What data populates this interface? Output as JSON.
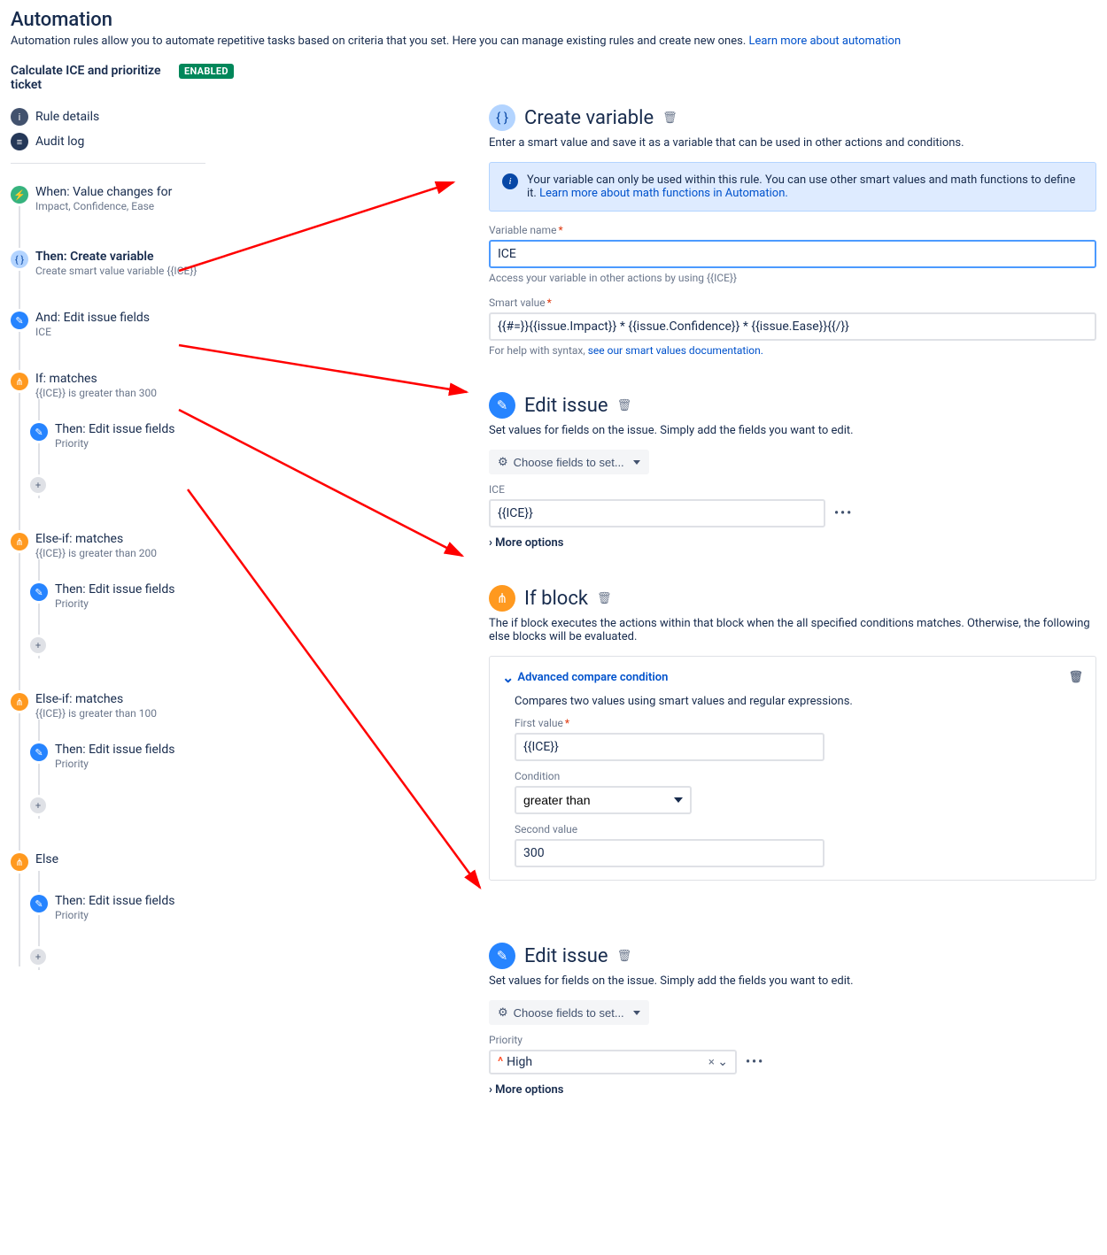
{
  "header": {
    "title": "Automation",
    "intro_text": "Automation rules allow you to automate repetitive tasks based on criteria that you set. Here you can manage existing rules and create new ones. ",
    "intro_link": "Learn more about automation"
  },
  "rule": {
    "name": "Calculate ICE and prioritize ticket",
    "status": "ENABLED"
  },
  "leftnav": {
    "details": "Rule details",
    "audit": "Audit log"
  },
  "tree": {
    "when": {
      "title": "When: Value changes for",
      "sub": "Impact, Confidence, Ease"
    },
    "then_create": {
      "title": "Then: Create variable",
      "sub": "Create smart value variable {{ICE}}"
    },
    "and_edit": {
      "title": "And: Edit issue fields",
      "sub": "ICE"
    },
    "if1": {
      "title": "If: matches",
      "sub": "{{ICE}} is greater than 300"
    },
    "if1_then": {
      "title": "Then: Edit issue fields",
      "sub": "Priority"
    },
    "elif2": {
      "title": "Else-if: matches",
      "sub": "{{ICE}} is greater than 200"
    },
    "elif2_then": {
      "title": "Then: Edit issue fields",
      "sub": "Priority"
    },
    "elif3": {
      "title": "Else-if: matches",
      "sub": "{{ICE}} is greater than 100"
    },
    "elif3_then": {
      "title": "Then: Edit issue fields",
      "sub": "Priority"
    },
    "else": {
      "title": "Else"
    },
    "else_then": {
      "title": "Then: Edit issue fields",
      "sub": "Priority"
    }
  },
  "panels": {
    "create_var": {
      "title": "Create variable",
      "desc": "Enter a smart value and save it as a variable that can be used in other actions and conditions.",
      "info_pre": "Your variable can only be used within this rule. You can use other smart values and math functions to define it. ",
      "info_link": "Learn more about math functions in Automation.",
      "var_label": "Variable name",
      "var_value": "ICE",
      "var_help": "Access your variable in other actions by using {{ICE}}",
      "sv_label": "Smart value",
      "sv_value": "{{#=}}{{issue.Impact}} * {{issue.Confidence}} * {{issue.Ease}}{{/}}",
      "sv_help_pre": "For help with syntax, ",
      "sv_help_link": "see our smart values documentation."
    },
    "edit1": {
      "title": "Edit issue",
      "desc": "Set values for fields on the issue. Simply add the fields you want to edit.",
      "choose": "Choose fields to set...",
      "field_label": "ICE",
      "field_value": "{{ICE}}",
      "more": "More options"
    },
    "ifblock": {
      "title": "If block",
      "desc": "The if block executes the actions within that block when the all specified conditions matches. Otherwise, the following else blocks will be evaluated.",
      "cond_title": "Advanced compare condition",
      "cond_desc": "Compares two values using smart values and regular expressions.",
      "first_label": "First value",
      "first_value": "{{ICE}}",
      "cond_label": "Condition",
      "cond_value": "greater than",
      "second_label": "Second value",
      "second_value": "300"
    },
    "edit2": {
      "title": "Edit issue",
      "desc": "Set values for fields on the issue. Simply add the fields you want to edit.",
      "choose": "Choose fields to set...",
      "field_label": "Priority",
      "field_value": "High",
      "more": "More options"
    }
  }
}
